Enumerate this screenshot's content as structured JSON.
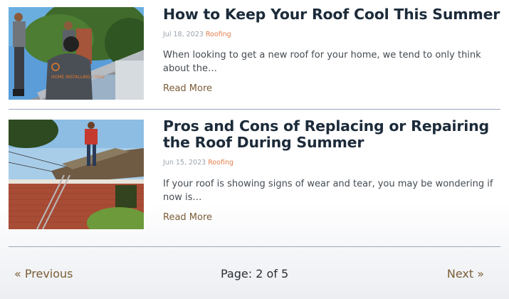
{
  "posts": [
    {
      "title": "How to Keep Your Roof Cool This Summer",
      "date": "Jul 18, 2023",
      "category": "Roofing",
      "excerpt": "When looking to get a new roof for your home, we tend to only think about the…",
      "read_more": "Read More",
      "image_text": "HOME INSTALLING CREW"
    },
    {
      "title": "Pros and Cons of Replacing or Repairing the Roof During Summer",
      "date": "Jun 15, 2023",
      "category": "Roofing",
      "excerpt": "If your roof is showing signs of wear and tear, you may be wondering if now is…",
      "read_more": "Read More"
    }
  ],
  "pagination": {
    "previous": "« Previous",
    "page": "Page: 2 of 5",
    "next": "Next »"
  },
  "colors": {
    "link": "#7b5c36",
    "category": "#e57e4d",
    "divider": "#9aa8bb"
  }
}
